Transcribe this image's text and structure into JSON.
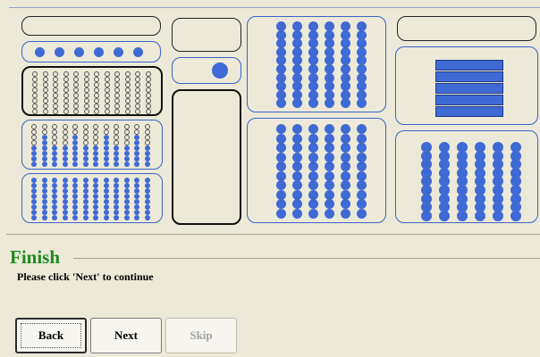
{
  "wizard": {
    "title": "Finish",
    "instruction": "Please click 'Next' to continue"
  },
  "buttons": {
    "back": "Back",
    "next": "Next",
    "skip": "Skip"
  },
  "colors": {
    "accent": "#3f6ad5",
    "title_green": "#1f8a1f",
    "panel": "#ece9d8"
  }
}
